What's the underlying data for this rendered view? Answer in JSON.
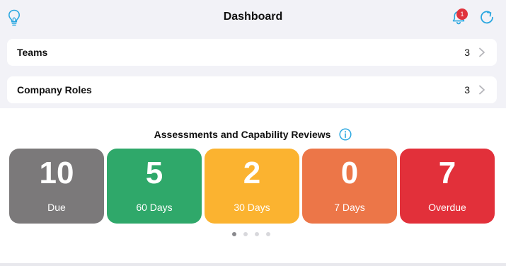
{
  "header": {
    "title": "Dashboard",
    "left_icon": "lightbulb-icon",
    "notification_icon": "bell-icon",
    "notification_count": "1",
    "refresh_icon": "refresh-icon",
    "accent_color": "#2aa7e0"
  },
  "rows": [
    {
      "label": "Teams",
      "count": "3",
      "icon": "chevron-right-icon"
    },
    {
      "label": "Company Roles",
      "count": "3",
      "icon": "chevron-right-icon"
    }
  ],
  "assessments": {
    "title": "Assessments and Capability Reviews",
    "info_icon": "info-icon",
    "tiles": [
      {
        "value": "10",
        "label": "Due",
        "color": "#7b797a"
      },
      {
        "value": "5",
        "label": "60 Days",
        "color": "#2fa86a"
      },
      {
        "value": "2",
        "label": "30 Days",
        "color": "#fbb330"
      },
      {
        "value": "0",
        "label": "7 Days",
        "color": "#ec7648"
      },
      {
        "value": "7",
        "label": "Overdue",
        "color": "#e2303a"
      }
    ],
    "page_count": 4,
    "active_page": 1
  }
}
